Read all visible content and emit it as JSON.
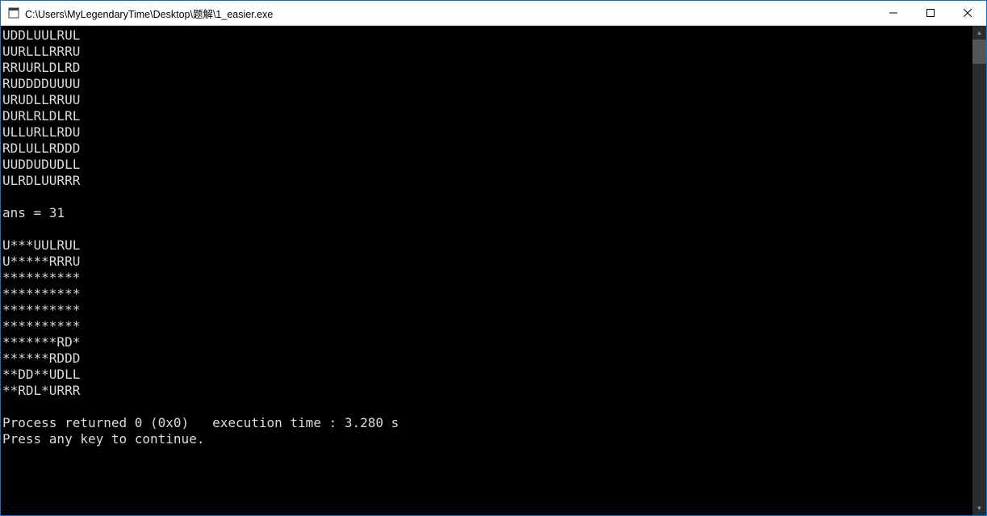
{
  "window": {
    "title": "C:\\Users\\MyLegendaryTime\\Desktop\\题解\\1_easier.exe"
  },
  "console": {
    "lines": [
      "UDDLUULRUL",
      "UURLLLRRRU",
      "RRUURLDLRD",
      "RUDDDDUUUU",
      "URUDLLRRUU",
      "DURLRLDLRL",
      "ULLURLLRDU",
      "RDLULLRDDD",
      "UUDDUDUDLL",
      "ULRDLUURRR",
      "",
      "ans = 31",
      "",
      "U***UULRUL",
      "U*****RRRU",
      "**********",
      "**********",
      "**********",
      "**********",
      "*******RD*",
      "******RDDD",
      "**DD**UDLL",
      "**RDL*URRR",
      "",
      "Process returned 0 (0x0)   execution time : 3.280 s",
      "Press any key to continue."
    ]
  }
}
